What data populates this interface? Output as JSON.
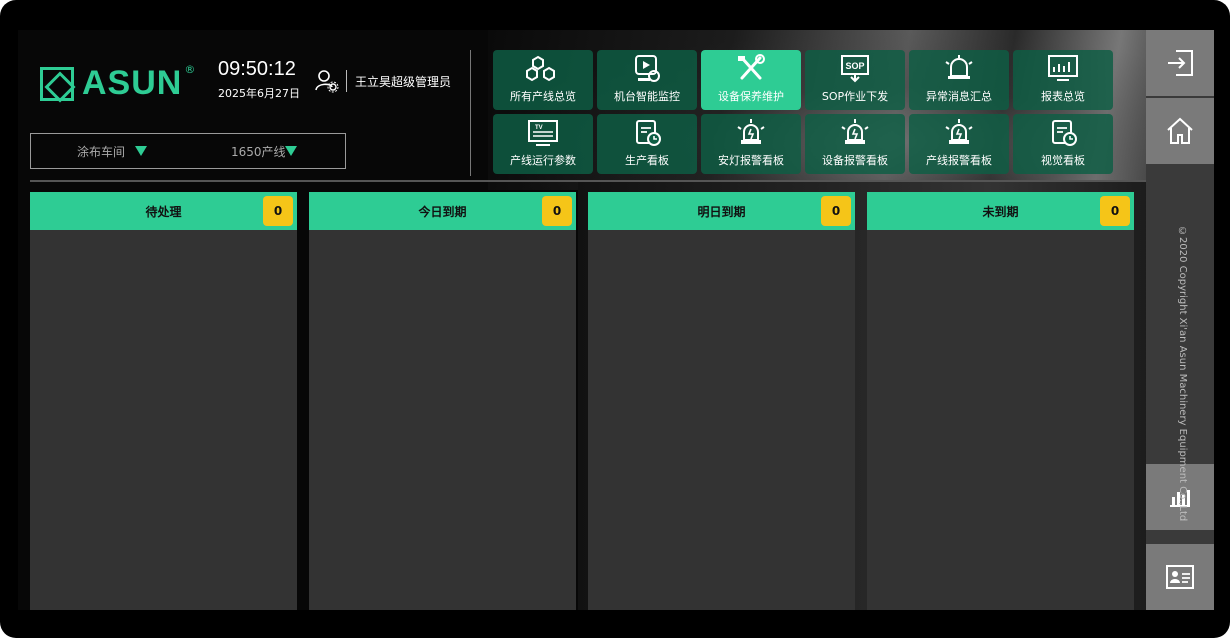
{
  "brand": {
    "name": "ASUN",
    "registered": "®"
  },
  "clock": {
    "time": "09:50:12",
    "date": "2025年6月27日"
  },
  "user": {
    "name": "王立昊超级管理员"
  },
  "selectors": {
    "workshop": "涂布车间",
    "line": "1650产线"
  },
  "nav": {
    "row1": [
      {
        "label": "所有产线总览",
        "icon": "cubes-icon"
      },
      {
        "label": "机台智能监控",
        "icon": "video-camera-icon"
      },
      {
        "label": "设备保养维护",
        "icon": "tools-icon",
        "active": true
      },
      {
        "label": "SOP作业下发",
        "icon": "sop-icon"
      },
      {
        "label": "异常消息汇总",
        "icon": "bell-icon"
      },
      {
        "label": "报表总览",
        "icon": "report-chart-icon"
      }
    ],
    "row2": [
      {
        "label": "产线运行参数",
        "icon": "tv-icon"
      },
      {
        "label": "生产看板",
        "icon": "clipboard-clock-icon"
      },
      {
        "label": "安灯报警看板",
        "icon": "alarm-light-icon"
      },
      {
        "label": "设备报警看板",
        "icon": "alarm-light-icon"
      },
      {
        "label": "产线报警看板",
        "icon": "alarm-light-icon"
      },
      {
        "label": "视觉看板",
        "icon": "clipboard-clock-icon"
      }
    ]
  },
  "columns": [
    {
      "title": "待处理",
      "count": "0"
    },
    {
      "title": "今日到期",
      "count": "0"
    },
    {
      "title": "明日到期",
      "count": "0"
    },
    {
      "title": "未到期",
      "count": "0"
    }
  ],
  "rail": {
    "buttons": [
      "logout-icon",
      "home-icon",
      "bar-chart-icon",
      "id-card-icon"
    ],
    "copyright": "©2020 Copyright Xi'an Asun Machinery Equipment Co.,Ltd"
  },
  "colors": {
    "accent": "#2ecc94",
    "badge": "#f5c518",
    "panel": "#333333"
  }
}
